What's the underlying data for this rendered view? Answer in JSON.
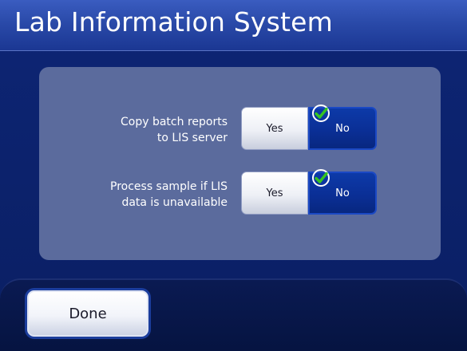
{
  "title": "Lab Information System",
  "settings": [
    {
      "label": "Copy batch reports\nto LIS server",
      "yes_label": "Yes",
      "no_label": "No",
      "selected": "No"
    },
    {
      "label": "Process sample if LIS\ndata is unavailable",
      "yes_label": "Yes",
      "no_label": "No",
      "selected": "No"
    }
  ],
  "footer": {
    "done_label": "Done"
  },
  "colors": {
    "background": "#0b2168",
    "panel": "#5b6b9d",
    "selected_toggle": "#0a2e94",
    "check": "#35c421"
  }
}
